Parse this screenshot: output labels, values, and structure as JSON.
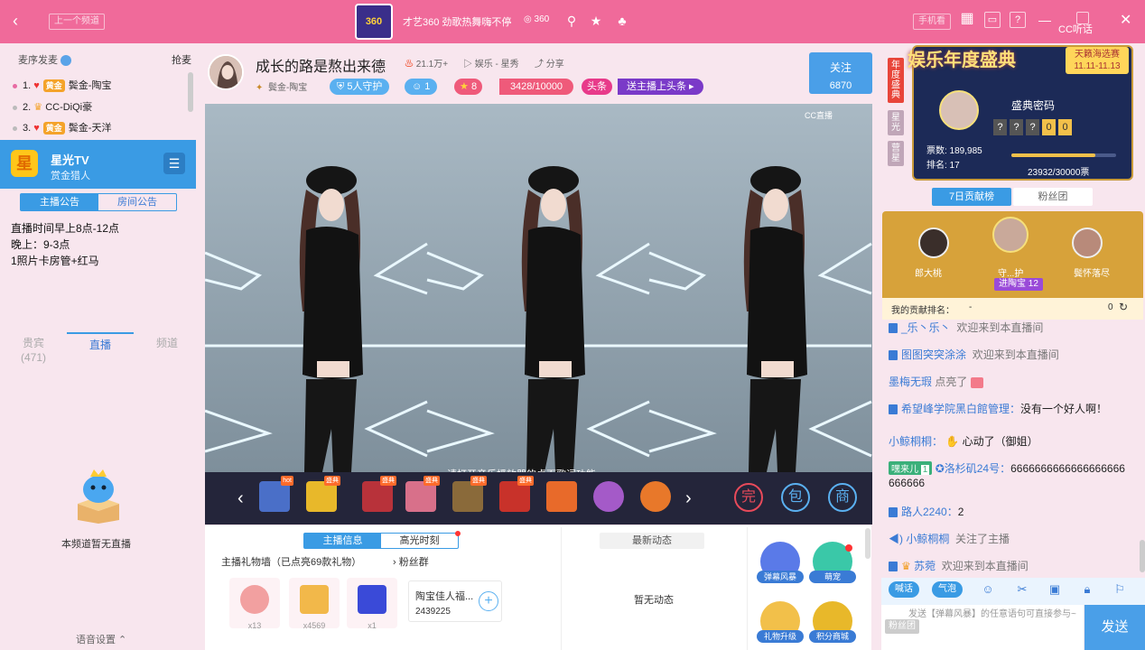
{
  "topbar": {
    "back_icon": "chevron-left-icon",
    "prev_channel": "上一个频道",
    "logo_text": "360",
    "marquee": "才艺360 劲歌热舞嗨不停",
    "viewers": "360",
    "phone_watch": "手机看",
    "cc_label": "CC听话",
    "accent": "#f06a9a"
  },
  "left": {
    "rank_header": "麦序发麦",
    "grab_mic": "抢麦",
    "rank": [
      {
        "no": "1.",
        "badge": "黄金",
        "name": "鬓金-陶宝"
      },
      {
        "no": "2.",
        "badge": "",
        "name": "CC-DiQi豪"
      },
      {
        "no": "3.",
        "badge": "黄金",
        "name": "鬓金-天洋"
      }
    ],
    "channel": {
      "icon": "星",
      "name": "星光TV",
      "sub": "赏金猎人"
    },
    "notice_tabs": [
      "主播公告",
      "房间公告"
    ],
    "notice_lines": [
      "直播时间早上8点-12点",
      "晚上：9-3点",
      "1照片卡房管+红马"
    ],
    "view_tabs": [
      {
        "label": "贵宾",
        "count": "(471)"
      },
      {
        "label": "直播",
        "count": ""
      },
      {
        "label": "频道",
        "count": ""
      }
    ],
    "empty_text": "本频道暂无直播",
    "voice_settings": "语音设置"
  },
  "room": {
    "title": "成长的路是熬出来德",
    "hot": "21.1万+",
    "category": "娱乐 - 星秀",
    "share": "分享",
    "anchor_tag": "鬓金-陶宝",
    "guard": "5人守护",
    "fans_count": "1",
    "level": "8",
    "exp": "3428/10000",
    "headline_tag": "头条",
    "headline_btn": "送主播上头条",
    "follow_label": "关注",
    "follow_count": "6870",
    "video_watermark": "CC直播",
    "subtitle": "请打开音乐播放器的桌面歌词功能"
  },
  "giftbar": {
    "items": [
      {
        "tag": "hot",
        "name": "gift-1"
      },
      {
        "tag": "盛典",
        "name": "gift-2"
      },
      {
        "tag": "盛典",
        "name": "gift-3"
      },
      {
        "tag": "盛典",
        "name": "gift-4"
      },
      {
        "tag": "盛典",
        "name": "gift-5"
      },
      {
        "tag": "盛典",
        "name": "gift-6"
      },
      {
        "tag": "",
        "name": "gift-7"
      },
      {
        "tag": "",
        "name": "gift-8"
      },
      {
        "tag": "",
        "name": "gift-9"
      }
    ],
    "right_icons": [
      "完",
      "包",
      "商"
    ]
  },
  "lower": {
    "info_tabs": [
      "主播信息",
      "高光时刻"
    ],
    "gift_wall": "主播礼物墙（已点亮69款礼物）",
    "fans_group": "粉丝群",
    "gifts": [
      {
        "count": "x13"
      },
      {
        "count": "x4569"
      },
      {
        "count": "x1"
      }
    ],
    "fanclub_name": "陶宝佳人福...",
    "fanclub_id": "2439225",
    "news_header": "最新动态",
    "news_empty": "暂无动态",
    "actions": [
      "弹幕风暴",
      "萌宠",
      "礼物升级",
      "积分商城"
    ]
  },
  "right": {
    "side_tabs": [
      "年度盛典",
      "星光",
      "营星"
    ],
    "award_title": "娱乐年度盛典",
    "award_sel": "天籁海选赛",
    "award_dates": "11.11-11.13",
    "award_subtitle": "盛典密码",
    "award_code": [
      "?",
      "?",
      "?",
      "0",
      "0"
    ],
    "votes": "票数: 189,985",
    "rank_no": "排名: 17",
    "progress": "23932/30000票",
    "progress_value": 0.798,
    "contrib_tabs": [
      "7日贡献榜",
      "粉丝团"
    ],
    "podium_names": [
      "郎大桃",
      "守...护",
      "鬓怀落尽"
    ],
    "podium_guard": "进陶宝 12",
    "my_rank": "我的贡献排名：",
    "my_rank_value": "-",
    "my_value": "0",
    "chat": [
      {
        "name": "_乐丶乐丶",
        "msg": "欢迎来到本直播间"
      },
      {
        "name": "图图突突涂涂",
        "msg": "欢迎来到本直播间"
      },
      {
        "name": "墨梅无瑕",
        "msg": "点亮了"
      },
      {
        "name": "希望峰学院黑白館管理：",
        "msg": "没有一个好人啊！"
      },
      {
        "name": "小鲸桐桐：",
        "msg": "心动了（御姐）"
      },
      {
        "name": "洛杉矶24号：",
        "msg": "6666666666666666666"
      },
      {
        "name": "路人2240：",
        "msg": "2"
      },
      {
        "name": "小鲸桐桐",
        "msg": "关注了主播"
      },
      {
        "name": "苏菀",
        "msg": "欢迎来到本直播间"
      }
    ],
    "chat_badge": "嘿来儿",
    "chat_badge_lv": "1",
    "tools": [
      "喊话",
      "气泡"
    ],
    "input_badge": "粉丝团",
    "input_placeholder": "发送【弹幕风暴】的任意语句可直接参与~",
    "send": "发送"
  }
}
